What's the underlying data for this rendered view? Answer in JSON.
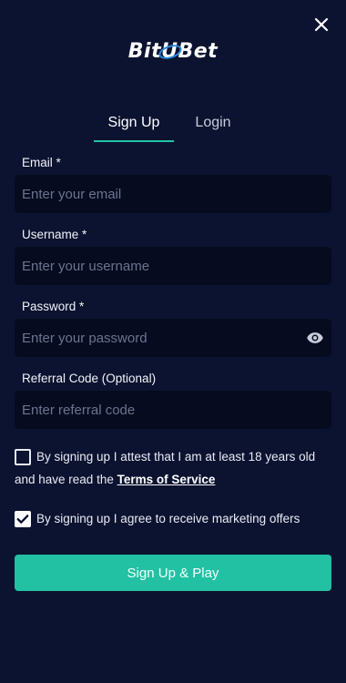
{
  "header": {
    "logo_left": "Bit",
    "logo_mid": "U",
    "logo_right": "Bet",
    "close_icon": "close-icon"
  },
  "tabs": [
    {
      "label": "Sign Up",
      "active": true
    },
    {
      "label": "Login",
      "active": false
    }
  ],
  "form": {
    "email": {
      "label": "Email",
      "required_mark": "*",
      "placeholder": "Enter your email",
      "value": ""
    },
    "username": {
      "label": "Username",
      "required_mark": "*",
      "placeholder": "Enter your username",
      "value": ""
    },
    "password": {
      "label": "Password",
      "required_mark": "*",
      "placeholder": "Enter your password",
      "value": "",
      "toggle_icon": "eye-icon"
    },
    "referral": {
      "label": "Referral Code (Optional)",
      "placeholder": "Enter referral code",
      "value": ""
    }
  },
  "agreements": {
    "age": {
      "text": "By signing up I attest that I am at least 18 years old and have read the ",
      "link": "Terms of Service",
      "checked": false
    },
    "marketing": {
      "text": "By signing up I agree to receive marketing offers",
      "checked": true
    }
  },
  "submit_label": "Sign Up & Play",
  "colors": {
    "background": "#0c1330",
    "field": "#060b1f",
    "accent": "#22c1a4"
  }
}
